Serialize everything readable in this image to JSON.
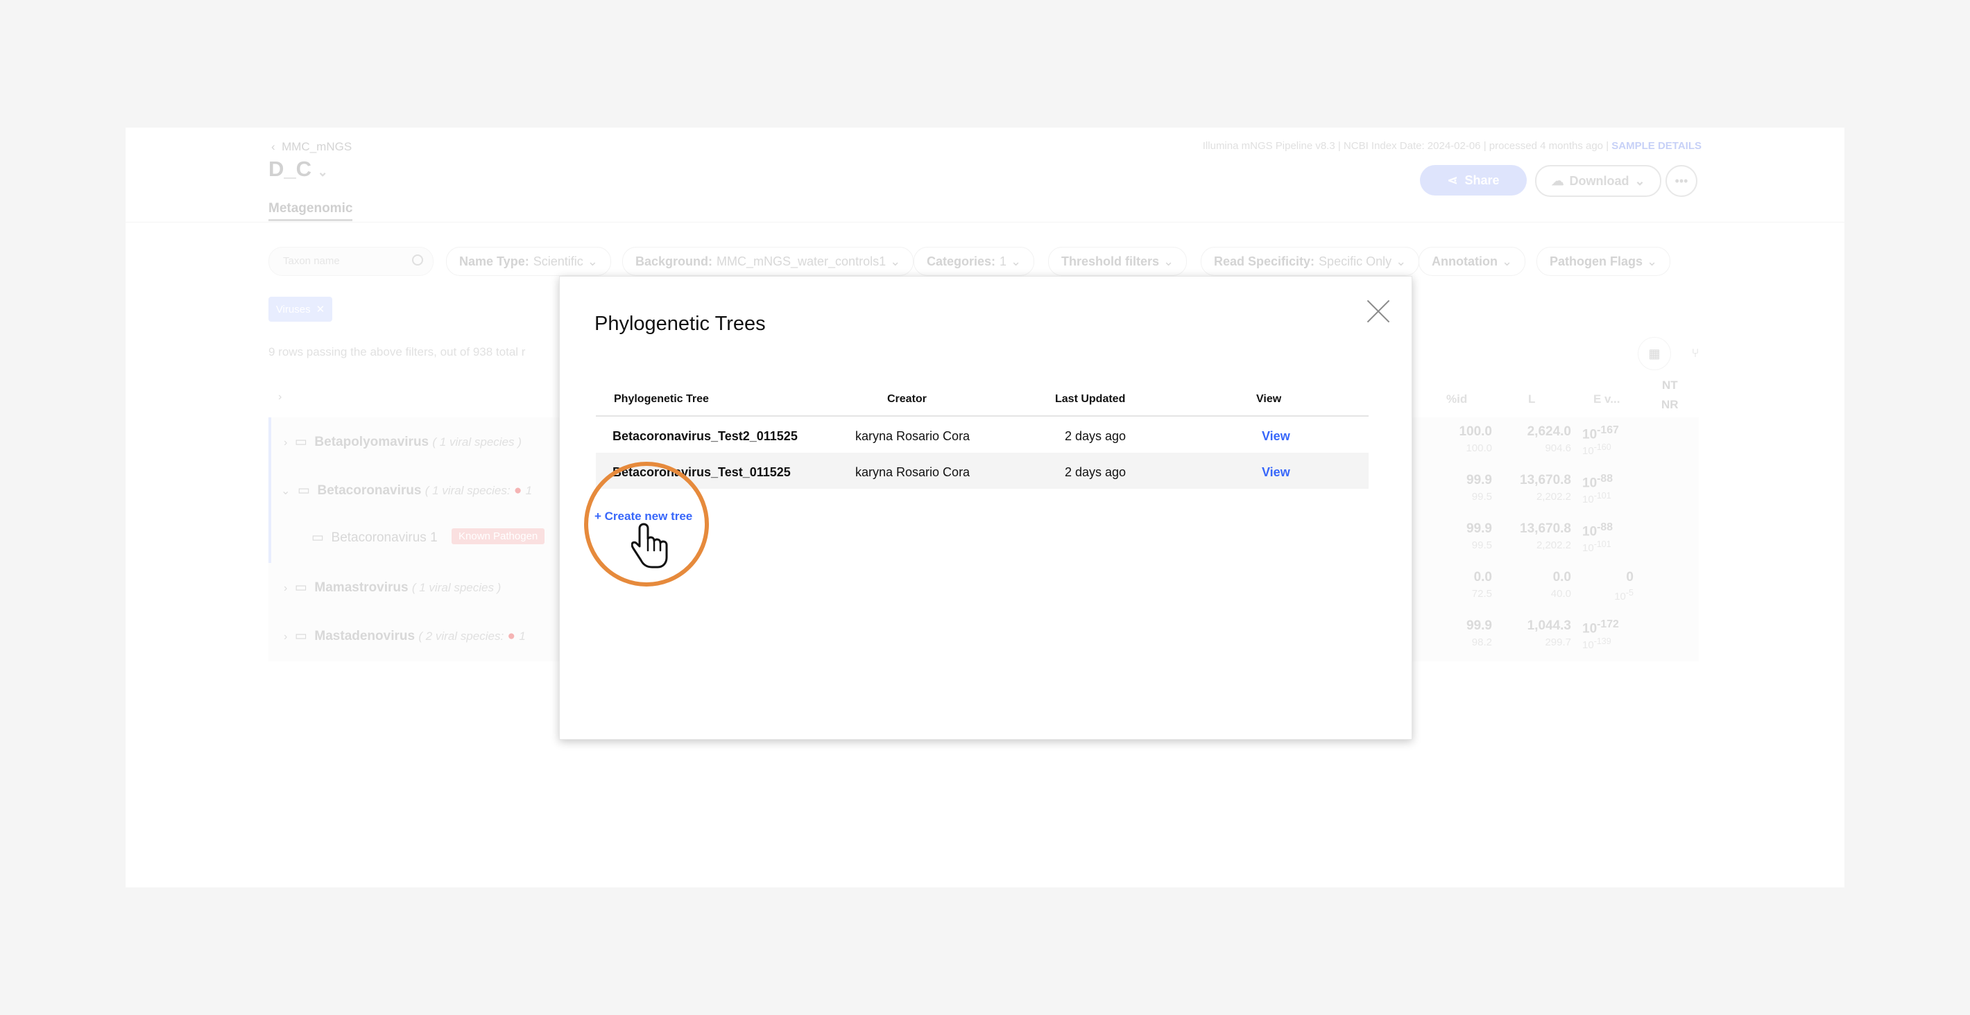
{
  "header": {
    "breadcrumb": "MMC_mNGS",
    "sample_name": "D_C",
    "pipeline_info": "Illumina mNGS Pipeline v8.3 | NCBI Index Date: 2024-02-06 | processed 4 months ago |",
    "sample_details": "SAMPLE DETAILS",
    "share_label": "Share",
    "download_label": "Download",
    "tab": "Metagenomic"
  },
  "filters": {
    "search_placeholder": "Taxon name",
    "name_type_label": "Name Type:",
    "name_type_value": "Scientific",
    "background_label": "Background:",
    "background_value": "MMC_mNGS_water_controls1",
    "categories_label": "Categories:",
    "categories_value": "1",
    "threshold_label": "Threshold filters",
    "read_spec_label": "Read Specificity:",
    "read_spec_value": "Specific Only",
    "annotation_label": "Annotation",
    "pathogen_flags_label": "Pathogen Flags",
    "chip_label": "Viruses"
  },
  "results": {
    "row_count": "9 rows passing the above filters, out of 938 total r",
    "columns": {
      "pid": "%id",
      "l": "L",
      "ev": "E v...",
      "nt": "NT",
      "nr": "NR"
    },
    "rows": [
      {
        "name": "Betapolyomavirus",
        "meta": "( 1 viral species )",
        "pid": "100.0",
        "pid2": "100.0",
        "l": "2,624.0",
        "l2": "904.6",
        "e": "10",
        "e_exp": "-167",
        "e2": "10",
        "e2_exp": "-160"
      },
      {
        "name": "Betacoronavirus",
        "meta": "( 1 viral species:",
        "count": "1",
        "pid": "99.9",
        "pid2": "99.5",
        "l": "13,670.8",
        "l2": "2,202.2",
        "e": "10",
        "e_exp": "-88",
        "e2": "10",
        "e2_exp": "-101"
      },
      {
        "name": "Betacoronavirus 1",
        "tag": "Known Pathogen",
        "pid": "99.9",
        "pid2": "99.5",
        "l": "13,670.8",
        "l2": "2,202.2",
        "e": "10",
        "e_exp": "-88",
        "e2": "10",
        "e2_exp": "-101"
      },
      {
        "name": "Mamastrovirus",
        "meta": "( 1 viral species )",
        "pid": "0.0",
        "pid2": "72.5",
        "l": "0.0",
        "l2": "40.0",
        "e": "0",
        "e_exp": "",
        "e2": "10",
        "e2_exp": "-5"
      },
      {
        "name": "Mastadenovirus",
        "meta": "( 2 viral species:",
        "count": "1",
        "pid": "99.9",
        "pid2": "98.2",
        "l": "1,044.3",
        "l2": "299.7",
        "e": "10",
        "e_exp": "-172",
        "e2": "10",
        "e2_exp": "-139"
      }
    ]
  },
  "modal": {
    "title": "Phylogenetic Trees",
    "columns": [
      "Phylogenetic Tree",
      "Creator",
      "Last Updated",
      "View"
    ],
    "rows": [
      {
        "tree": "Betacoronavirus_Test2_011525",
        "creator": "karyna Rosario Cora",
        "updated": "2 days ago",
        "view": "View"
      },
      {
        "tree": "Betacoronavirus_Test_011525",
        "creator": "karyna Rosario Cora",
        "updated": "2 days ago",
        "view": "View"
      }
    ],
    "create_label": "+ Create new tree"
  },
  "colors": {
    "accent": "#3867fa",
    "callout": "#e68a3c",
    "pathogen_tag": "#f8cfcf"
  }
}
